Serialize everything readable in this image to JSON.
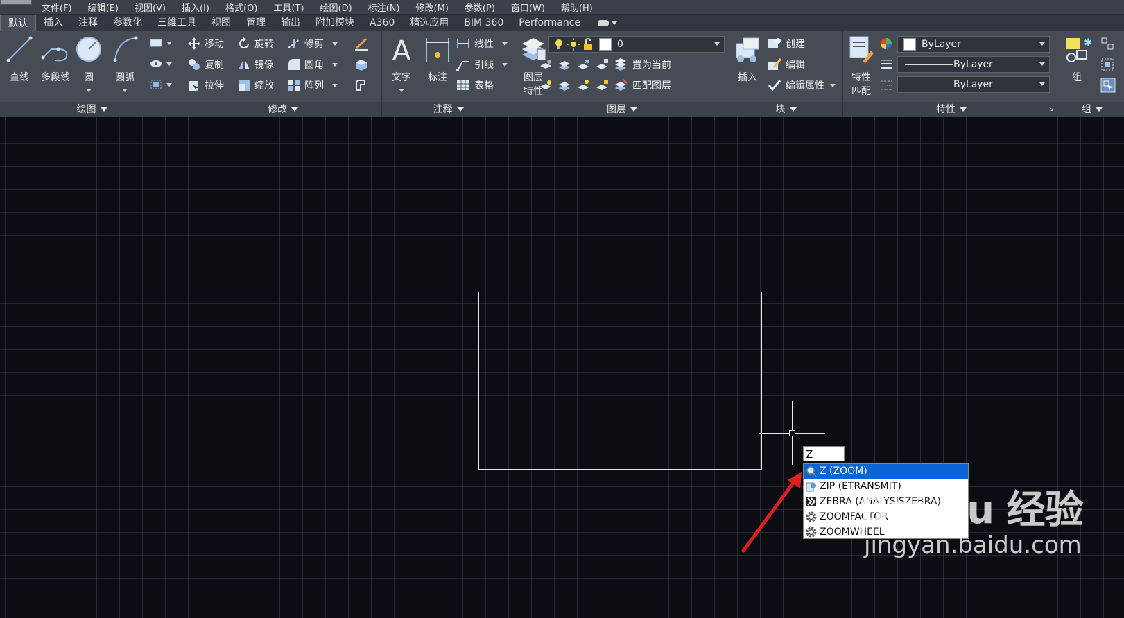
{
  "menubar": {
    "items": [
      "文件(F)",
      "编辑(E)",
      "视图(V)",
      "插入(I)",
      "格式(O)",
      "工具(T)",
      "绘图(D)",
      "标注(N)",
      "修改(M)",
      "参数(P)",
      "窗口(W)",
      "帮助(H)"
    ]
  },
  "tabs": [
    "默认",
    "插入",
    "注释",
    "参数化",
    "三维工具",
    "视图",
    "管理",
    "输出",
    "附加模块",
    "A360",
    "精选应用",
    "BIM 360",
    "Performance"
  ],
  "ribbon": {
    "draw": {
      "title": "绘图",
      "line": "直线",
      "polyline": "多段线",
      "circle": "圆",
      "arc": "圆弧"
    },
    "modify": {
      "title": "修改",
      "move": "移动",
      "rotate": "旋转",
      "trim": "修剪",
      "copy": "复制",
      "mirror": "镜像",
      "fillet": "圆角",
      "stretch": "拉伸",
      "scale": "缩放",
      "array": "阵列"
    },
    "annotation": {
      "title": "注释",
      "text": "文字",
      "dimension": "标注",
      "linear": "线性",
      "leader": "引线",
      "table": "表格"
    },
    "layers": {
      "title": "图层",
      "layer_properties_1": "图层",
      "layer_properties_2": "特性",
      "current_layer": "0",
      "set_current": "置为当前",
      "match_layer": "匹配图层"
    },
    "block": {
      "title": "块",
      "insert": "插入",
      "create": "创建",
      "edit": "编辑",
      "edit_attributes": "编辑属性"
    },
    "properties": {
      "title": "特性",
      "match_1": "特性",
      "match_2": "匹配",
      "color": "ByLayer",
      "linetype": "ByLayer",
      "lineweight": "ByLayer"
    },
    "groups": {
      "title": "组",
      "group": "组"
    }
  },
  "command": {
    "input_value": "Z",
    "suggestions": [
      {
        "label": "Z (ZOOM)",
        "icon": "zoom-icon",
        "selected": true
      },
      {
        "label": "ZIP (ETRANSMIT)",
        "icon": "etransmit-icon",
        "selected": false
      },
      {
        "label": "ZEBRA (ANALYSISZEBRA)",
        "icon": "zebra-icon",
        "selected": false
      },
      {
        "label": "ZOOMFACTOR",
        "icon": "gear-icon",
        "selected": false
      },
      {
        "label": "ZOOMWHEEL",
        "icon": "gear-icon",
        "selected": false
      }
    ]
  },
  "watermark": {
    "logo": "Bai du 经验",
    "url": "jingyan.baidu.com"
  },
  "colors": {
    "selection": "#0a64d8",
    "arrow": "#e02020",
    "canvas": "#0b0d12",
    "ribbon": "#464b54"
  }
}
